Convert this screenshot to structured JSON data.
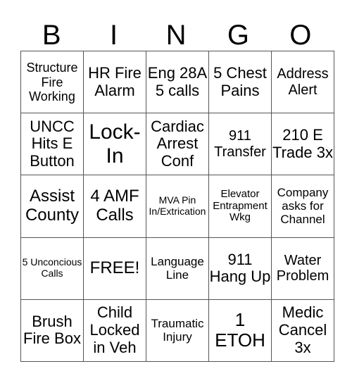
{
  "header": [
    "B",
    "I",
    "N",
    "G",
    "O"
  ],
  "rows": [
    [
      "Structure Fire Working",
      "HR Fire Alarm",
      "Eng 28A 5 calls",
      "5 Chest Pains",
      "Address Alert"
    ],
    [
      "UNCC Hits E Button",
      "Lock-In",
      "Cardiac Arrest Conf",
      "911 Transfer",
      "210 E Trade 3x"
    ],
    [
      "Assist County",
      "4 AMF Calls",
      "MVA Pin In/Extrication",
      "Elevator Entrapment Wkg",
      "Company asks for Channel"
    ],
    [
      "5 Unconcious Calls",
      "FREE!",
      "Language Line",
      "911 Hang Up",
      "Water Problem"
    ],
    [
      "Brush Fire Box",
      "Child Locked in Veh",
      "Traumatic Injury",
      "1 ETOH",
      "Medic Cancel 3x"
    ]
  ]
}
